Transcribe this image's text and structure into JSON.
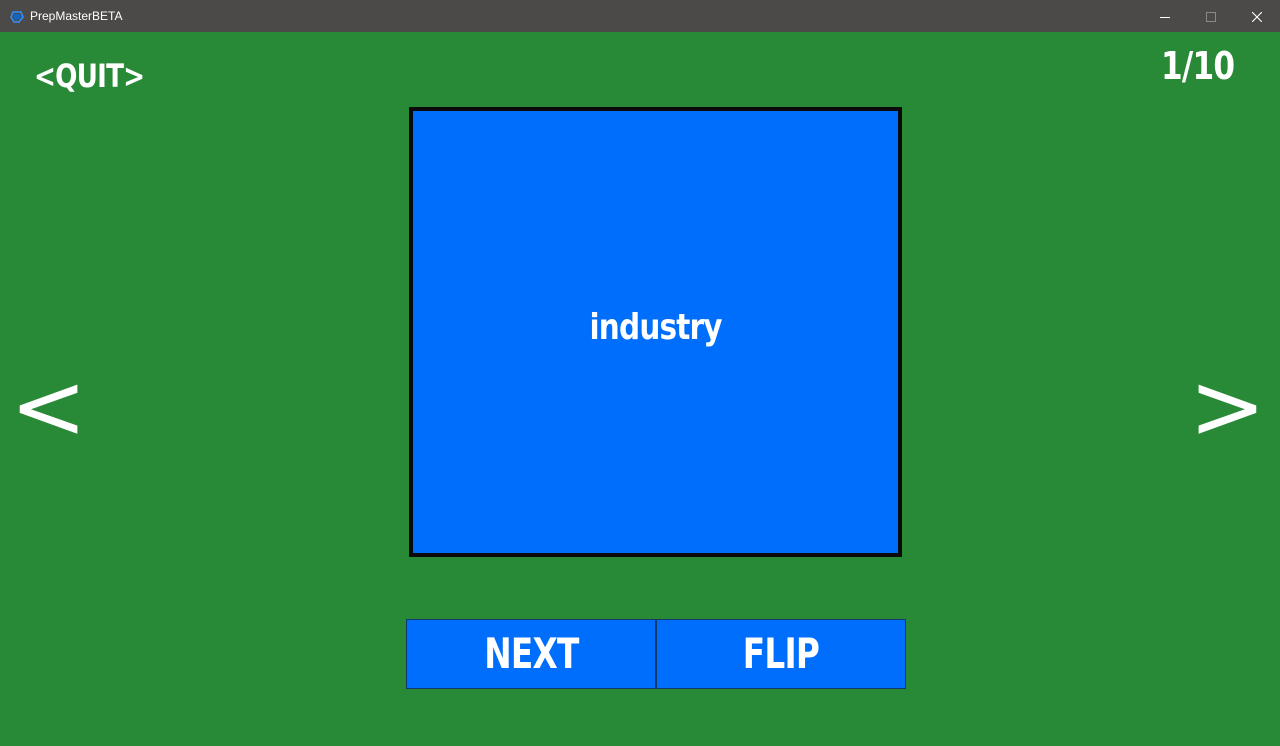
{
  "window": {
    "title": "PrepMasterBETA",
    "icon": "app-logo-icon",
    "controls": [
      "minimize-icon",
      "maximize-icon",
      "close-icon"
    ]
  },
  "header": {
    "quit_label": "<QUIT>",
    "counter": "1/10"
  },
  "navigation": {
    "prev_label": "<",
    "next_label": ">"
  },
  "card": {
    "word": "industry"
  },
  "buttons": {
    "next_label": "NEXT",
    "flip_label": "FLIP"
  },
  "colors": {
    "background": "#288937",
    "card": "#006efc",
    "titlebar": "#4b4a48",
    "text": "#ffffff"
  }
}
